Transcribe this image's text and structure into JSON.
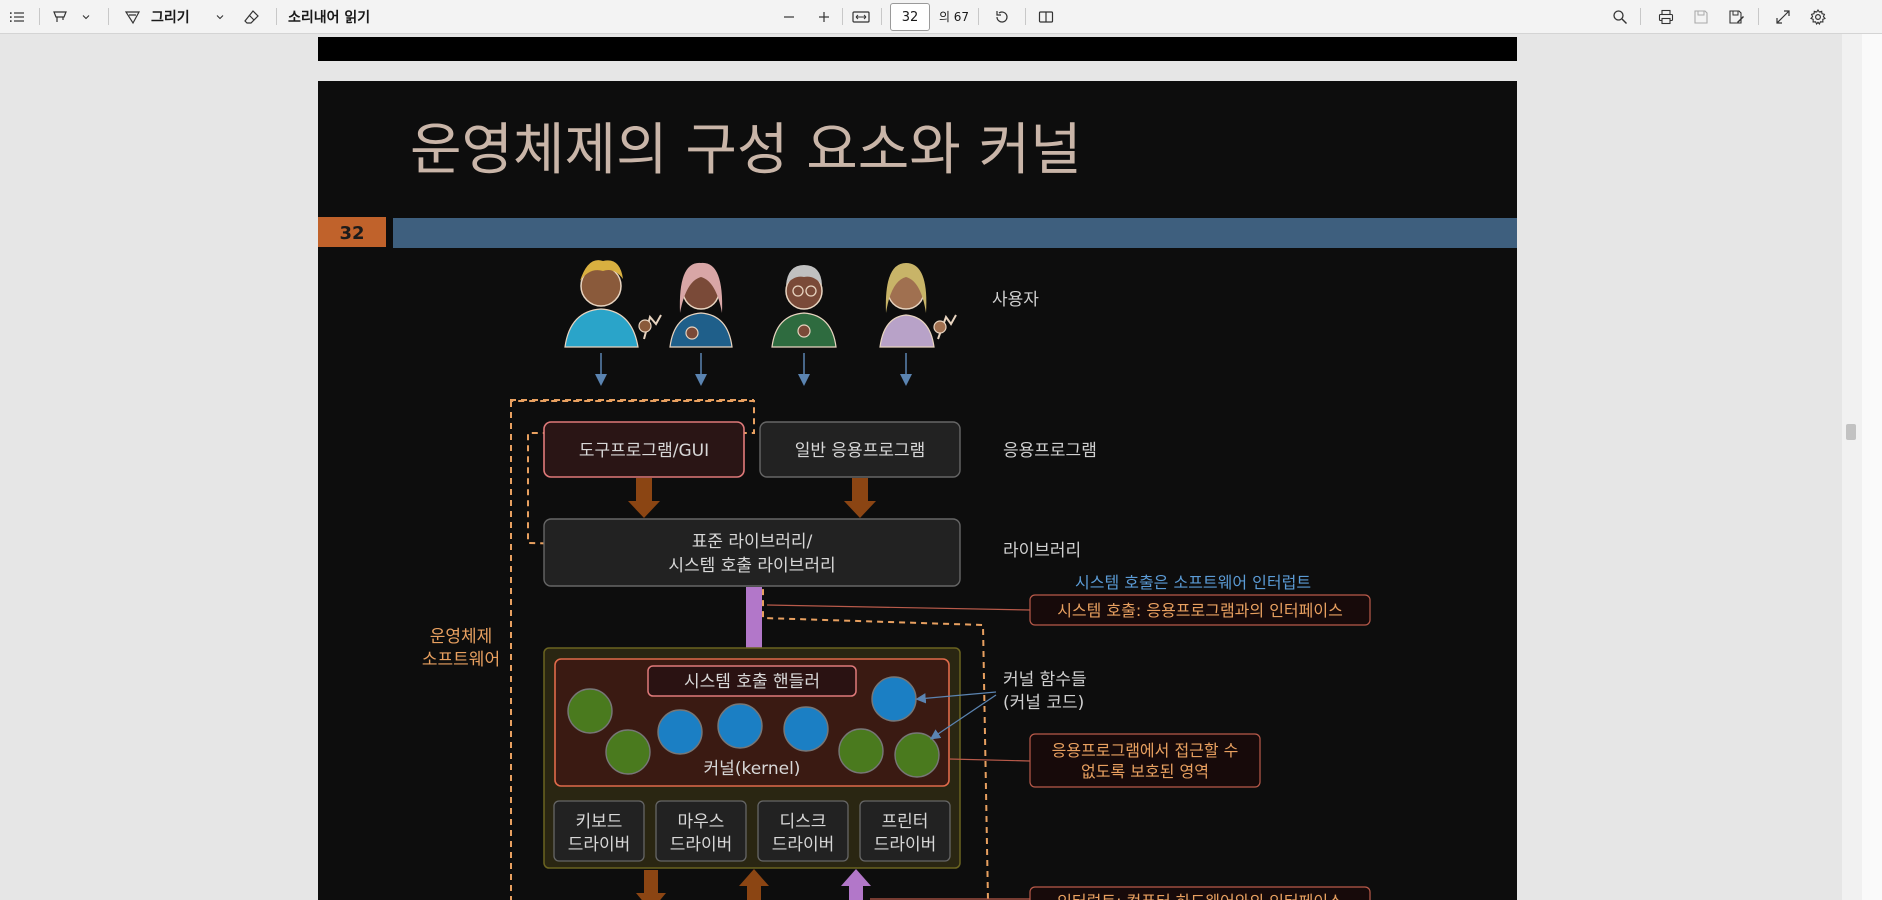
{
  "toolbar": {
    "draw_label": "그리기",
    "read_aloud_label": "소리내어 읽기",
    "page_current": "32",
    "page_total": "의 67"
  },
  "slide": {
    "title": "운영체제의 구성 요소와 커널",
    "page_number": "32",
    "labels": {
      "users": "사용자",
      "applications": "응용프로그램",
      "library": "라이브러리",
      "os_line1": "운영체제",
      "os_line2": "소프트웨어",
      "kernel_funcs_line1": "커널 함수들",
      "kernel_funcs_line2": "(커널 코드)"
    },
    "boxes": {
      "utility_gui": "도구프로그램/GUI",
      "general_app": "일반 응용프로그램",
      "library_line1": "표준 라이브러리/",
      "library_line2": "시스템 호출 라이브러리",
      "syscall_handler": "시스템 호출 핸들러",
      "kernel": "커널(kernel)",
      "drivers": [
        {
          "line1": "키보드",
          "line2": "드라이버"
        },
        {
          "line1": "마우스",
          "line2": "드라이버"
        },
        {
          "line1": "디스크",
          "line2": "드라이버"
        },
        {
          "line1": "프린터",
          "line2": "드라이버"
        }
      ]
    },
    "annotations": {
      "syscall_soft_interrupt": "시스템 호출은 소프트웨어 인터럽트",
      "syscall_interface": "시스템 호출: 응용프로그램과의 인터페이스",
      "protected_line1": "응용프로그램에서 접근할 수",
      "protected_line2": "없도록 보호된 영역",
      "interrupt_interface": "인터럽트: 컴퓨터 하드웨어와의 인터페이스"
    }
  },
  "colors": {
    "slide_bg": "#0d0d0d",
    "title": "#c9b5a8",
    "page_badge": "#c0622b",
    "header_bar": "#3e5f7e",
    "orange_text": "#e8a060",
    "blue_text": "#5b9bd5",
    "kernel_box": "#e06a4a",
    "green_circle": "#4a7a1e",
    "blue_circle": "#1b7fc4",
    "purple_arrow": "#b277c9",
    "brown_arrow": "#8b4513"
  }
}
